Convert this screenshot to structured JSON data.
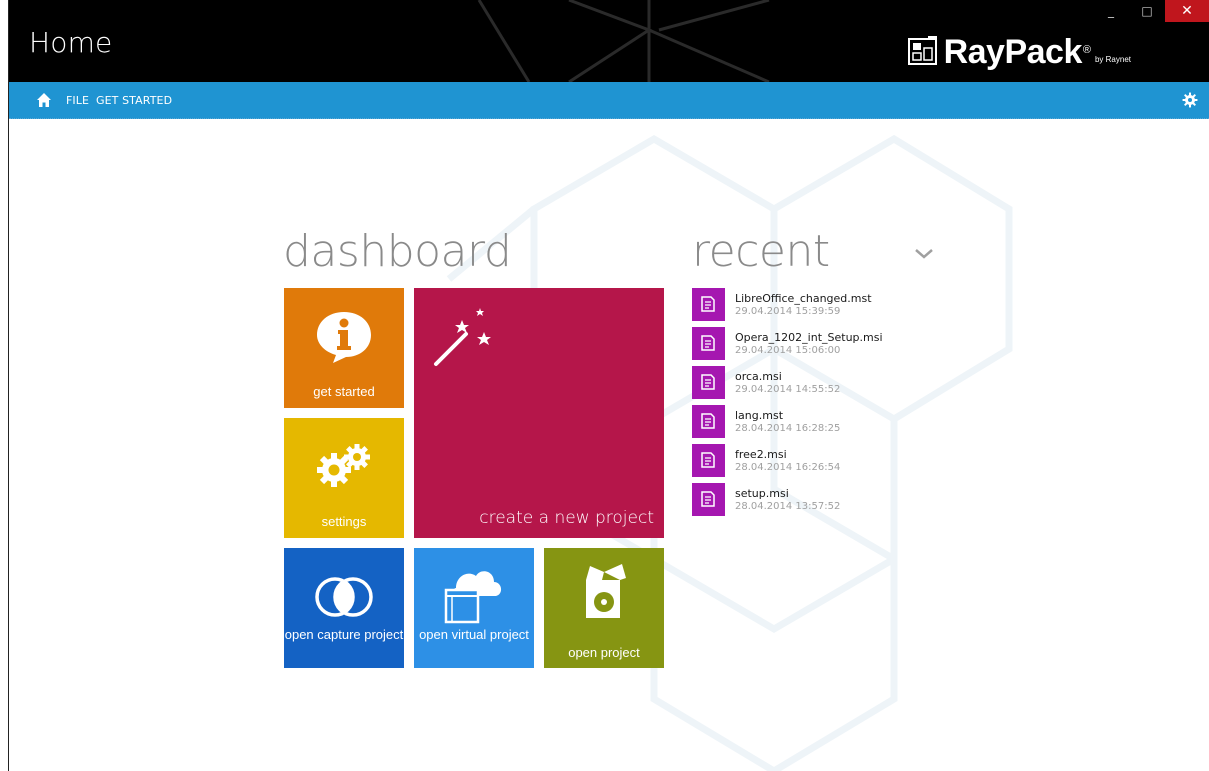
{
  "window": {
    "title": "Home",
    "controls": {
      "minimize": "_",
      "maximize": "□",
      "close": "✕"
    }
  },
  "brand": {
    "name": "RayPack",
    "registered": "®",
    "by": "by Raynet"
  },
  "nav": {
    "items": [
      "FILE",
      "GET STARTED"
    ],
    "home_icon": "home-icon",
    "settings_icon": "gear-icon"
  },
  "dashboard": {
    "heading": "dashboard",
    "tiles": [
      {
        "label": "get started",
        "icon": "info-icon",
        "color": "#e07a0a"
      },
      {
        "label": "settings",
        "icon": "gears-icon",
        "color": "#e5b800"
      },
      {
        "label": "create a new project",
        "icon": "magic-wand-icon",
        "color": "#b5164a"
      },
      {
        "label": "open capture project",
        "icon": "capture-circles-icon",
        "color": "#1462c4"
      },
      {
        "label": "open virtual project",
        "icon": "cloud-window-icon",
        "color": "#2d90e6"
      },
      {
        "label": "open project",
        "icon": "package-icon",
        "color": "#869512"
      }
    ]
  },
  "recent": {
    "heading": "recent",
    "toggle_icon": "chevron-down-icon",
    "items": [
      {
        "name": "LibreOffice_changed.mst",
        "date": "29.04.2014 15:39:59"
      },
      {
        "name": "Opera_1202_int_Setup.msi",
        "date": "29.04.2014 15:06:00"
      },
      {
        "name": "orca.msi",
        "date": "29.04.2014 14:55:52"
      },
      {
        "name": "lang.mst",
        "date": "28.04.2014 16:28:25"
      },
      {
        "name": "free2.msi",
        "date": "28.04.2014 16:26:54"
      },
      {
        "name": "setup.msi",
        "date": "28.04.2014 13:57:52"
      }
    ],
    "file_icon_color": "#a517b0"
  },
  "colors": {
    "nav": "#1f94d2",
    "titlebar": "#000000",
    "close": "#c0161d"
  }
}
